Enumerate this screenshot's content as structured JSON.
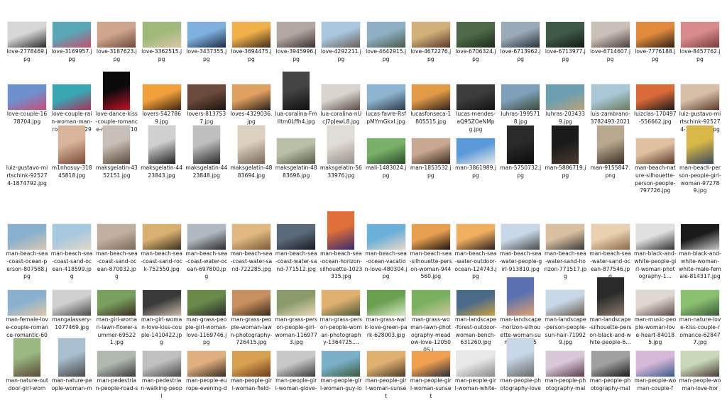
{
  "colors": {
    "background": "#ffffff",
    "text": "#1a1a1a"
  },
  "files": [
    {
      "name": "love-2778469.jpg",
      "orientation": "landscape",
      "tone": [
        "#d7d7d7",
        "#2b2b2b"
      ]
    },
    {
      "name": "love-3169957.jpg",
      "orientation": "landscape",
      "tone": [
        "#5aa7b8",
        "#c2506e"
      ]
    },
    {
      "name": "love-3187623.jpg",
      "orientation": "landscape",
      "tone": [
        "#cfa58d",
        "#6e4a3c"
      ]
    },
    {
      "name": "love-3362515.jpg",
      "orientation": "landscape",
      "tone": [
        "#9fb97a",
        "#d9c7a8"
      ]
    },
    {
      "name": "love-3437355.jpg",
      "orientation": "landscape",
      "tone": [
        "#7fb1df",
        "#1b2b45"
      ]
    },
    {
      "name": "love-3694475.jpg",
      "orientation": "landscape",
      "tone": [
        "#f0b04a",
        "#3b2a1a"
      ]
    },
    {
      "name": "love-3945996.jpg",
      "orientation": "landscape",
      "tone": [
        "#b2a7a2",
        "#3a3030"
      ]
    },
    {
      "name": "love-4292211.jpg",
      "orientation": "landscape",
      "tone": [
        "#a9c7df",
        "#6a5f5a"
      ]
    },
    {
      "name": "love-4642915.jpg",
      "orientation": "landscape",
      "tone": [
        "#8fb0c4",
        "#4a5a4a"
      ]
    },
    {
      "name": "love-4672276.jpg",
      "orientation": "landscape",
      "tone": [
        "#d1b07a",
        "#5a3a28"
      ]
    },
    {
      "name": "love-6706324.jpg",
      "orientation": "landscape",
      "tone": [
        "#4e6a48",
        "#1d2a1b"
      ]
    },
    {
      "name": "love-6713962.jpg",
      "orientation": "landscape",
      "tone": [
        "#9aaab8",
        "#2a3238"
      ]
    },
    {
      "name": "love-6713977.jpg",
      "orientation": "landscape",
      "tone": [
        "#3f5a48",
        "#121a14"
      ]
    },
    {
      "name": "love-6714607.jpg",
      "orientation": "landscape",
      "tone": [
        "#c9c0b7",
        "#4b3f3a"
      ]
    },
    {
      "name": "love-7776188.jpg",
      "orientation": "landscape",
      "tone": [
        "#e08a3c",
        "#2f1f14"
      ]
    },
    {
      "name": "love-8457762.jpg",
      "orientation": "landscape",
      "tone": [
        "#d98c8c",
        "#7a3b3b"
      ]
    },
    {
      "name": "love-couple-1678704.jpg",
      "orientation": "landscape",
      "tone": [
        "#6f8fcf",
        "#c94e7a"
      ]
    },
    {
      "name": "love-couple-rain-woman-man-romance-1629577.jpg",
      "orientation": "landscape",
      "tone": [
        "#3aa6b4",
        "#a8325a"
      ]
    },
    {
      "name": "love-dance-kiss-couple-romance-romantic-710644.jpg",
      "orientation": "portrait",
      "tone": [
        "#0a0a0a",
        "#c0122a"
      ]
    },
    {
      "name": "lovers-5427869.jpg",
      "orientation": "landscape",
      "tone": [
        "#f2a03c",
        "#3a2410"
      ]
    },
    {
      "name": "lovers-8137537.jpg",
      "orientation": "landscape",
      "tone": [
        "#6a4a3a",
        "#1a1410"
      ]
    },
    {
      "name": "loves-4329036.jpg",
      "orientation": "landscape",
      "tone": [
        "#e0a060",
        "#2a1e1a"
      ]
    },
    {
      "name": "lua-coralina-FmIltm0Lffh4.jpg",
      "orientation": "portrait",
      "tone": [
        "#444444",
        "#0f0f0f"
      ]
    },
    {
      "name": "lua-coralina-nUcJ7pJewL8.jpg",
      "orientation": "landscape",
      "tone": [
        "#d9d4cf",
        "#5a4c44"
      ]
    },
    {
      "name": "lucas-favre-RsfpMYmGkxI.jpg",
      "orientation": "landscape",
      "tone": [
        "#8fb4cf",
        "#2c3c4a"
      ]
    },
    {
      "name": "lucasfonseca-1805515.jpg",
      "orientation": "landscape",
      "tone": [
        "#e09a48",
        "#2e2218"
      ]
    },
    {
      "name": "lucas-mendes-aQ95ZOeNMpg.jpg",
      "orientation": "landscape",
      "tone": [
        "#3c3c3c",
        "#121212"
      ]
    },
    {
      "name": "luhras-1995718.jpg",
      "orientation": "landscape",
      "tone": [
        "#7fa0b8",
        "#3a4a3a"
      ]
    },
    {
      "name": "luhras-2034339.jpg",
      "orientation": "landscape",
      "tone": [
        "#6c9fb0",
        "#b8a27a"
      ]
    },
    {
      "name": "luis-zambrano-3782493-20219120.jpg",
      "orientation": "landscape",
      "tone": [
        "#a8c8d8",
        "#6a7a5a"
      ]
    },
    {
      "name": "luizclas-170497-556662.jpg",
      "orientation": "landscape",
      "tone": [
        "#d96a3a",
        "#1a1a1a"
      ]
    },
    {
      "name": "luiz-gustavo-mirtschink-925274-1874787.jpg",
      "orientation": "landscape",
      "tone": [
        "#d8c0a8",
        "#5a3a2a"
      ]
    },
    {
      "name": "luiz-gustavo-mirtschink-925274-1874792.jpg",
      "orientation": "landscape",
      "tone": [
        "#ffffff",
        "#ffffff"
      ],
      "blank": true
    },
    {
      "name": "m1nhosuy-31845818.jpg",
      "orientation": "portrait",
      "tone": [
        "#d8b49a",
        "#7a4a3a"
      ]
    },
    {
      "name": "maksgelatin-4352151.jpg",
      "orientation": "portrait",
      "tone": [
        "#c8c0b8",
        "#5a4a3a"
      ]
    },
    {
      "name": "maksgelatin-4423843.jpg",
      "orientation": "portrait",
      "tone": [
        "#d0d0d0",
        "#202020"
      ]
    },
    {
      "name": "maksgelatin-4423848.jpg",
      "orientation": "portrait",
      "tone": [
        "#bfbfbf",
        "#2a2a2a"
      ]
    },
    {
      "name": "maksgelatin-4883694.jpg",
      "orientation": "portrait",
      "tone": [
        "#dcd0c0",
        "#7a6a5a"
      ]
    },
    {
      "name": "maksgelatin-4883696.jpg",
      "orientation": "landscape",
      "tone": [
        "#b8c0a8",
        "#5a5a4a"
      ]
    },
    {
      "name": "maksgelatin-5633976.jpg",
      "orientation": "portrait",
      "tone": [
        "#e0dcd8",
        "#9a9088"
      ]
    },
    {
      "name": "mali-1483024.jpg",
      "orientation": "landscape",
      "tone": [
        "#7ab06a",
        "#2a4a2a"
      ]
    },
    {
      "name": "man-1853532.jpg",
      "orientation": "landscape",
      "tone": [
        "#c8a890",
        "#3a2a20"
      ]
    },
    {
      "name": "man-3861989.jpg",
      "orientation": "landscape",
      "tone": [
        "#5a9ad8",
        "#e8e8e8"
      ]
    },
    {
      "name": "man-5750732.jpg",
      "orientation": "portrait",
      "tone": [
        "#2a2a2a",
        "#0a0a0a"
      ]
    },
    {
      "name": "man-5886719.jpg",
      "orientation": "portrait",
      "tone": [
        "#1a1a1a",
        "#4a3a30"
      ]
    },
    {
      "name": "man-9155847.png",
      "orientation": "portrait",
      "tone": [
        "#b8a890",
        "#3a3028"
      ]
    },
    {
      "name": "man-beach-nature-silhouette-person-people-797726.jpg",
      "orientation": "landscape",
      "tone": [
        "#e0c0a0",
        "#5a3a2a"
      ]
    },
    {
      "name": "man-beach-person-people-girl-woman-972789.jpg",
      "orientation": "portrait",
      "tone": [
        "#d8b848",
        "#3a4a5a"
      ]
    },
    {
      "name": "man-beach-sea-coast-ocean-person-807588.jpg",
      "orientation": "landscape",
      "tone": [
        "#8ab0cf",
        "#d8c8b0"
      ]
    },
    {
      "name": "man-beach-sea-coast-sand-ocean-418599.jpg",
      "orientation": "landscape",
      "tone": [
        "#a8c8e0",
        "#e0d8c8"
      ]
    },
    {
      "name": "man-beach-sea-coast-sand-ocean-870032.jpg",
      "orientation": "landscape",
      "tone": [
        "#c0b0a0",
        "#7a6a5a"
      ]
    },
    {
      "name": "man-beach-sea-coast-sand-rock-752550.jpg",
      "orientation": "landscape",
      "tone": [
        "#d8b070",
        "#3a3020"
      ]
    },
    {
      "name": "man-beach-sea-coast-water-ocean-697800.jpg",
      "orientation": "landscape",
      "tone": [
        "#b0b8c0",
        "#2a2a2a"
      ]
    },
    {
      "name": "man-beach-sea-coast-water-sand-722285.jpg",
      "orientation": "landscape",
      "tone": [
        "#e0b880",
        "#7a5a3a"
      ]
    },
    {
      "name": "man-beach-sea-coast-water-sand-771512.jpg",
      "orientation": "landscape",
      "tone": [
        "#5a6a7a",
        "#1a1a20"
      ]
    },
    {
      "name": "man-beach-sea-ocean-horizon-silhouette-1023315.jpg",
      "orientation": "portrait",
      "tone": [
        "#e0703a",
        "#3a2a6a"
      ]
    },
    {
      "name": "man-beach-sea-ocean-vacation-love-480304.jpg",
      "orientation": "landscape",
      "tone": [
        "#6ab0d8",
        "#e8d8c8"
      ]
    },
    {
      "name": "man-beach-sea-silhouette-person-woman-944560.jpg",
      "orientation": "landscape",
      "tone": [
        "#e8a050",
        "#1a1410"
      ]
    },
    {
      "name": "man-beach-sea-water-outdoor-ocean-124743.jpg",
      "orientation": "landscape",
      "tone": [
        "#f0b060",
        "#2a2020"
      ]
    },
    {
      "name": "man-beach-sea-water-people-girl-913810.jpg",
      "orientation": "landscape",
      "tone": [
        "#c8d8e8",
        "#4a4a4a"
      ]
    },
    {
      "name": "man-beach-sea-water-sand-horizon-771517.jpg",
      "orientation": "landscape",
      "tone": [
        "#d8c0a0",
        "#3a3a3a"
      ]
    },
    {
      "name": "man-beach-sea-water-sand-ocean-877546.jpg",
      "orientation": "landscape",
      "tone": [
        "#e8d0b0",
        "#8a6a4a"
      ]
    },
    {
      "name": "man-black-and-white-people-girl-woman-photography-1...",
      "orientation": "landscape",
      "tone": [
        "#e0e0e0",
        "#303030"
      ]
    },
    {
      "name": "man-black-and-white-woman-white-male-female-814317.jpg",
      "orientation": "landscape",
      "tone": [
        "#1a1a1a",
        "#c8c8c8"
      ]
    },
    {
      "name": "man-female-love-couple-romance-romantic-601216.jpg",
      "orientation": "landscape",
      "tone": [
        "#8ab0d0",
        "#e0c8a8"
      ]
    },
    {
      "name": "mangalassery-1077469.jpg",
      "orientation": "landscape",
      "tone": [
        "#d0d0d0",
        "#4a4a4a"
      ]
    },
    {
      "name": "man-girl-woman-lawn-flower-summer-695221.jpg",
      "orientation": "landscape",
      "tone": [
        "#7aa060",
        "#3a2a20"
      ]
    },
    {
      "name": "man-girl-woman-love-kiss-couple-1410422.jpg",
      "orientation": "landscape",
      "tone": [
        "#3a3a3a",
        "#c8b8a8"
      ]
    },
    {
      "name": "man-grass-people-girl-woman-love-1169746.jpg",
      "orientation": "landscape",
      "tone": [
        "#6a8a4a",
        "#2a2a2a"
      ]
    },
    {
      "name": "man-grass-people-woman-lawn-photography-726415.jpg",
      "orientation": "landscape",
      "tone": [
        "#c89060",
        "#3a2a1a"
      ]
    },
    {
      "name": "man-grass-person-people-girl-woman-1169773.jpg",
      "orientation": "landscape",
      "tone": [
        "#8a9a6a",
        "#e8d8b8"
      ]
    },
    {
      "name": "man-grass-person-people-woman-photography-1364725....",
      "orientation": "landscape",
      "tone": [
        "#e0b070",
        "#4a5a3a"
      ]
    },
    {
      "name": "man-grass-walk-love-green-park-628003.jpg",
      "orientation": "landscape",
      "tone": [
        "#6aa050",
        "#d8e8c8"
      ]
    },
    {
      "name": "man-grass-woman-lawn-photography-meadow-love-1205005.j...",
      "orientation": "landscape",
      "tone": [
        "#7ab060",
        "#d0c8a0"
      ]
    },
    {
      "name": "man-landscape-forest-outdoor-woman-bench-631260.jpg",
      "orientation": "landscape",
      "tone": [
        "#4a6a8a",
        "#c8a040"
      ]
    },
    {
      "name": "man-landscape-horizon-silhouette-woman-sunrise-893051....",
      "orientation": "portrait",
      "tone": [
        "#5a70b0",
        "#e0a070"
      ]
    },
    {
      "name": "man-landscape-person-people-sun-hair-719929.jpg",
      "orientation": "landscape",
      "tone": [
        "#c8d8e8",
        "#6a5a4a"
      ]
    },
    {
      "name": "man-landscape-silhouette-person-black-and-white-people-6...",
      "orientation": "portrait",
      "tone": [
        "#2a2a2a",
        "#8a7a6a"
      ]
    },
    {
      "name": "man-music-people-woman-love-heart-840185.jpg",
      "orientation": "landscape",
      "tone": [
        "#e0d8d0",
        "#5a4a4a"
      ]
    },
    {
      "name": "man-nature-love-kiss-couple-romance-628477.jpg",
      "orientation": "landscape",
      "tone": [
        "#8ac070",
        "#3a5a3a"
      ]
    },
    {
      "name": "man-nature-outdoor-girl-wom",
      "orientation": "portrait",
      "tone": [
        "#9ab880",
        "#5a4a3a"
      ]
    },
    {
      "name": "man-nature-people-woman-m",
      "orientation": "portrait",
      "tone": [
        "#a8c0d0",
        "#4a4a4a"
      ]
    },
    {
      "name": "man-pedestrian-people-road-s",
      "orientation": "landscape",
      "tone": [
        "#b0b8b0",
        "#3a3a3a"
      ]
    },
    {
      "name": "man-pedestrian-walking-peopl",
      "orientation": "landscape",
      "tone": [
        "#c0c0c0",
        "#4a4a4a"
      ]
    },
    {
      "name": "man-people-europe-evening-d",
      "orientation": "landscape",
      "tone": [
        "#e0b080",
        "#3a2a20"
      ]
    },
    {
      "name": "man-people-girl-woman-field-",
      "orientation": "landscape",
      "tone": [
        "#d8a050",
        "#6a3a1a"
      ]
    },
    {
      "name": "man-people-girl-woman-glove-",
      "orientation": "landscape",
      "tone": [
        "#c8c8c8",
        "#3a3a3a"
      ]
    },
    {
      "name": "man-people-girl-woman-guy-lo",
      "orientation": "landscape",
      "tone": [
        "#7ab0c8",
        "#3a5a3a"
      ]
    },
    {
      "name": "man-people-girl-woman-sunset",
      "orientation": "landscape",
      "tone": [
        "#e0b070",
        "#4a3a2a"
      ]
    },
    {
      "name": "man-people-girl-woman-sunset",
      "orientation": "landscape",
      "tone": [
        "#f0a050",
        "#2a2a3a"
      ]
    },
    {
      "name": "man-people-girl-woman-white-",
      "orientation": "landscape",
      "tone": [
        "#e8e8e8",
        "#8a8a8a"
      ]
    },
    {
      "name": "man-people-photography-love",
      "orientation": "portrait",
      "tone": [
        "#c8d8e8",
        "#6a6a6a"
      ]
    },
    {
      "name": "man-people-photography-mal",
      "orientation": "landscape",
      "tone": [
        "#d8c8d8",
        "#5a3a4a"
      ]
    },
    {
      "name": "man-people-photography-mal",
      "orientation": "landscape",
      "tone": [
        "#a0a0a0",
        "#1a1a1a"
      ]
    },
    {
      "name": "man-people-woman-couple-f",
      "orientation": "landscape",
      "tone": [
        "#d8b8d8",
        "#3a5a8a"
      ]
    },
    {
      "name": "man-people-woman-love-hor",
      "orientation": "landscape",
      "tone": [
        "#c8d8b8",
        "#4a3a3a"
      ]
    }
  ]
}
